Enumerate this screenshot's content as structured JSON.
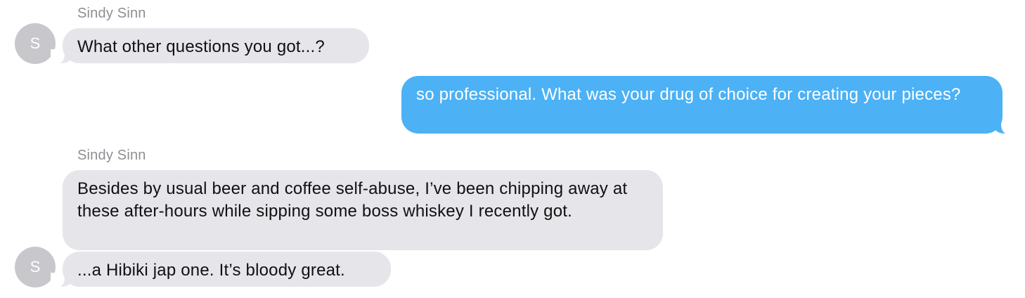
{
  "messages": [
    {
      "sender": "Sindy Sinn",
      "avatar_initial": "S",
      "text": "What other questions you got...?"
    },
    {
      "text": "so professional. What was your drug of choice for creating your pieces?"
    },
    {
      "sender": "Sindy Sinn",
      "text": "Besides by usual beer and coffee self-abuse, I’ve been chipping away at these after-hours while sipping some boss whiskey I recently got."
    },
    {
      "avatar_initial": "S",
      "text": "...a Hibiki jap one. It’s bloody great."
    }
  ],
  "colors": {
    "incoming_bubble": "#e5e5ea",
    "outgoing_bubble": "#4cb1f5",
    "avatar": "#c7c7cc",
    "sender_name": "#8e8e93"
  }
}
